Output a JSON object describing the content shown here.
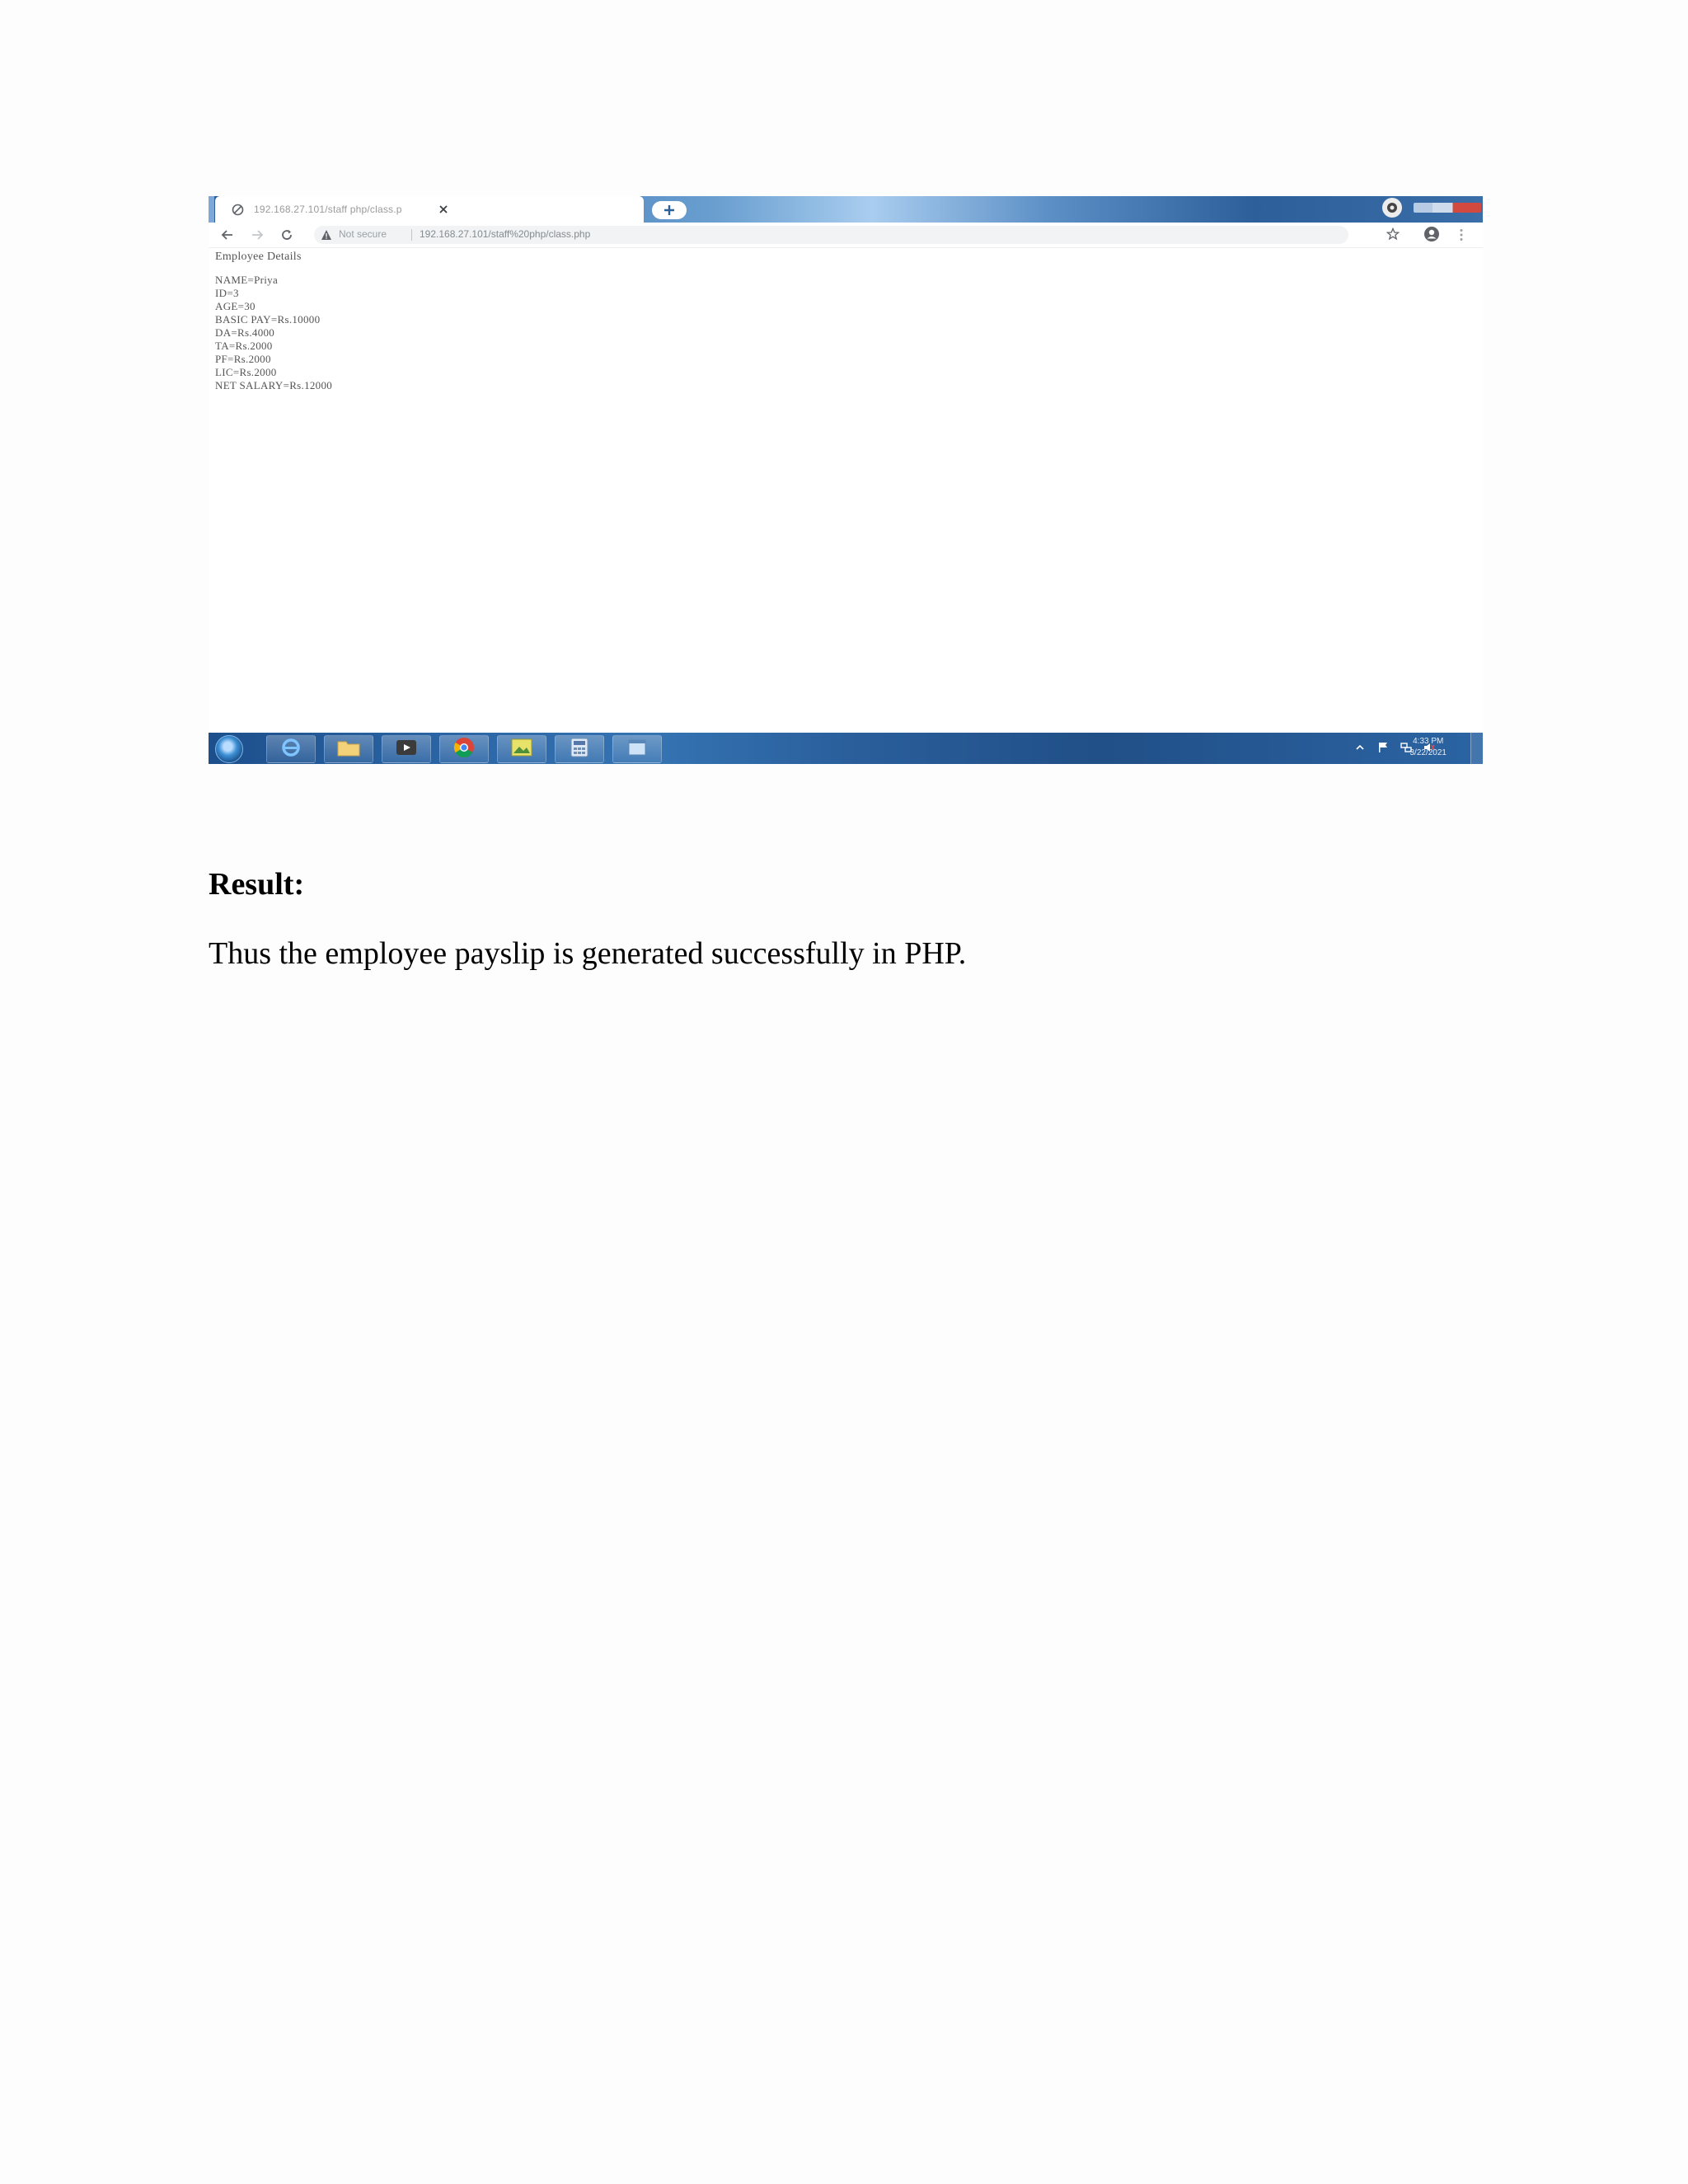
{
  "browser": {
    "tab_title": "192.168.27.101/staff php/class.p",
    "address": {
      "security_label": "Not secure",
      "url": "192.168.27.101/staff%20php/class.php"
    }
  },
  "page": {
    "heading": "Employee Details",
    "lines": [
      "NAME=Priya",
      "ID=3",
      "AGE=30",
      "BASIC PAY=Rs.10000",
      "DA=Rs.4000",
      "TA=Rs.2000",
      "PF=Rs.2000",
      "LIC=Rs.2000",
      "NET SALARY=Rs.12000"
    ]
  },
  "taskbar": {
    "apps": [
      "internet-explorer",
      "file-explorer",
      "media-player",
      "chrome",
      "image-viewer",
      "calculator",
      "window-app"
    ],
    "clock_time": "4:33 PM",
    "clock_date": "3/22/2021"
  },
  "document": {
    "result_heading": "Result:",
    "result_text": "Thus the employee payslip is generated successfully in PHP."
  }
}
